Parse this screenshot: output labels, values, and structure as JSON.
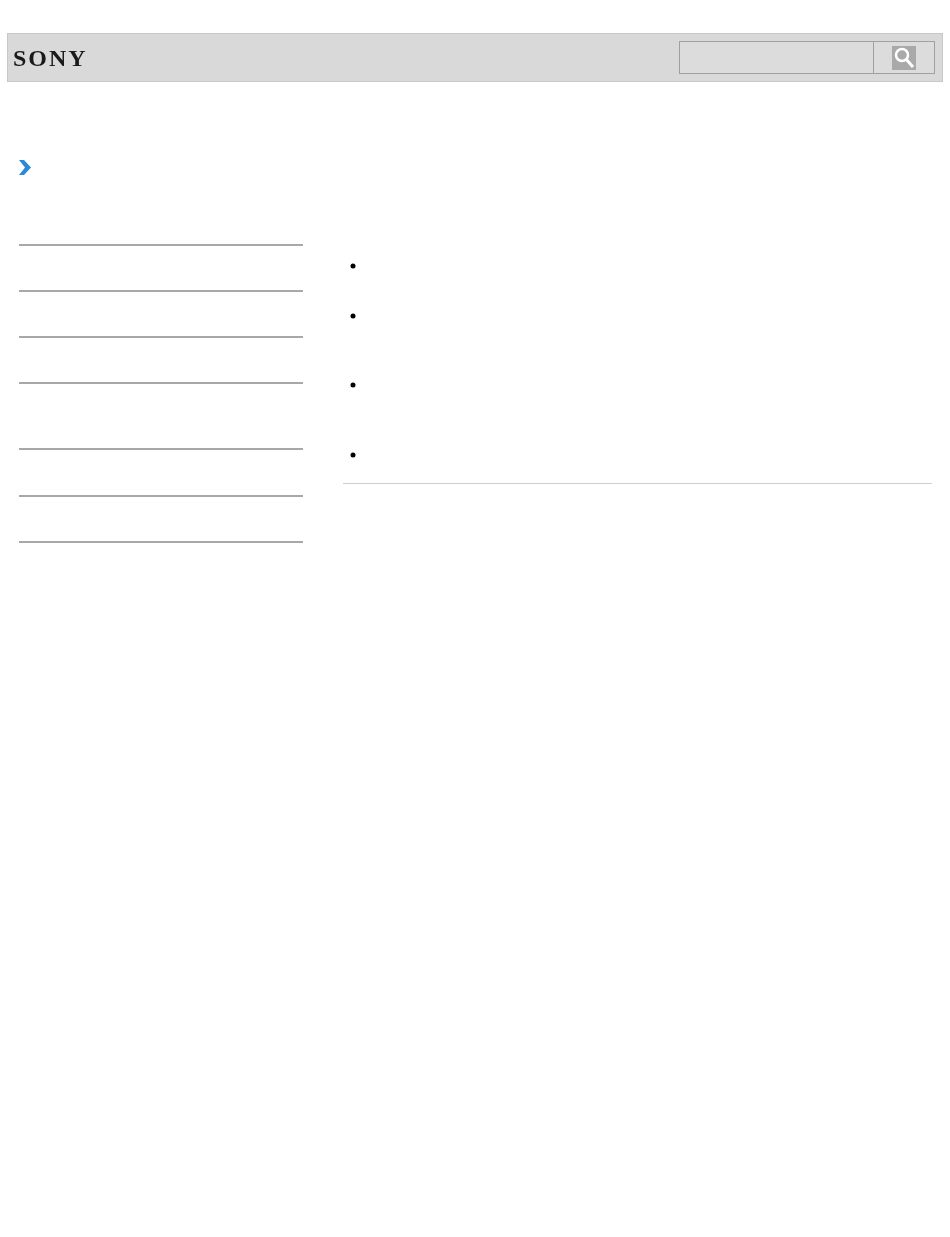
{
  "header": {
    "logo": "SONY"
  }
}
